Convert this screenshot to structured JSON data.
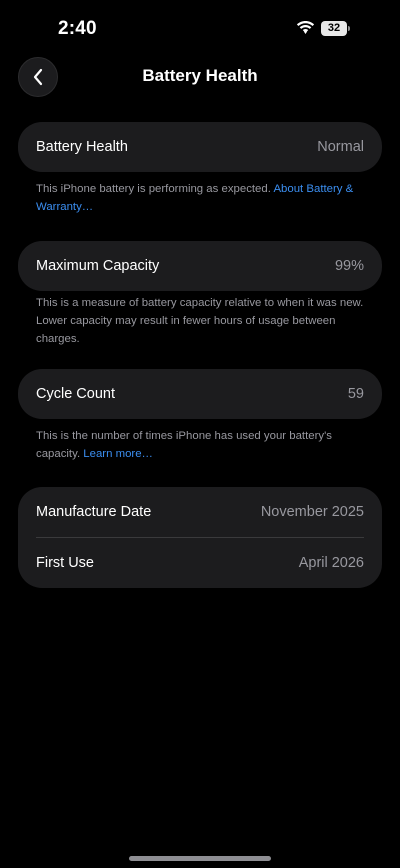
{
  "status_bar": {
    "time": "2:40",
    "battery_level": "32",
    "icons": [
      "wifi-icon",
      "battery-icon"
    ]
  },
  "nav": {
    "title": "Battery Health",
    "back_icon": "chevron-left-icon"
  },
  "battery_health": {
    "label": "Battery Health",
    "value": "Normal",
    "note": "This iPhone battery is performing as expected.",
    "note_link": "About Battery & Warranty…"
  },
  "maximum_capacity": {
    "label": "Maximum Capacity",
    "value": "99%",
    "note": "This is a measure of battery capacity relative to when it was new. Lower capacity may result in fewer hours of usage between charges."
  },
  "cycle_count": {
    "label": "Cycle Count",
    "value": "59",
    "note": "This is the number of times iPhone has used your battery's capacity.",
    "note_link": "Learn more…"
  },
  "dates": {
    "manufacture_label": "Manufacture Date",
    "manufacture_value": "November 2025",
    "first_use_label": "First Use",
    "first_use_value": "April 2026"
  },
  "colors": {
    "background": "#000000",
    "card": "#1c1c1e",
    "secondary_text": "#98989f",
    "link": "#3b8ef0"
  }
}
